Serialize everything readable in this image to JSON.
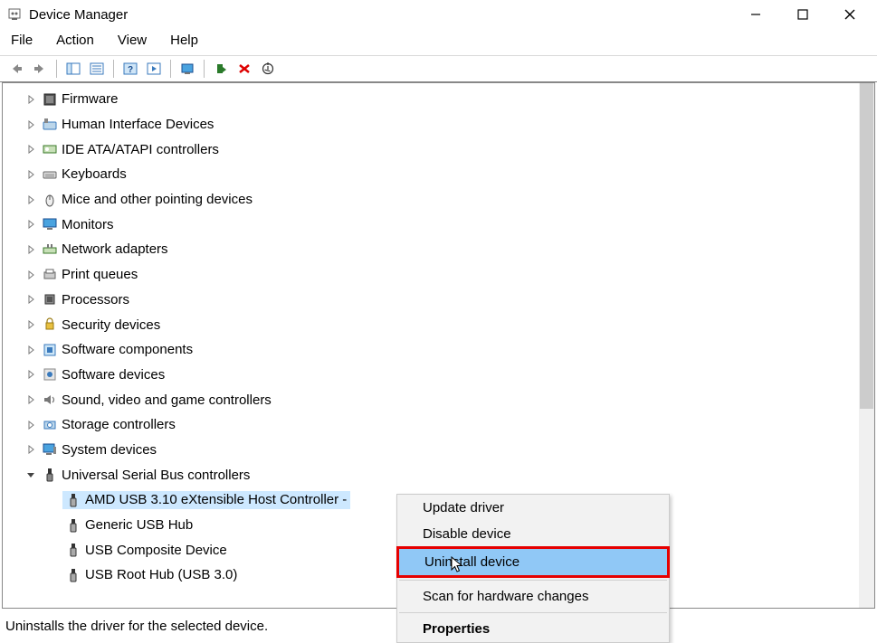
{
  "window": {
    "title": "Device Manager"
  },
  "menu": {
    "file": "File",
    "action": "Action",
    "view": "View",
    "help": "Help"
  },
  "tree": {
    "items": [
      {
        "icon": "firmware",
        "label": "Firmware",
        "expanded": false,
        "level": 1
      },
      {
        "icon": "hid",
        "label": "Human Interface Devices",
        "expanded": false,
        "level": 1
      },
      {
        "icon": "ide",
        "label": "IDE ATA/ATAPI controllers",
        "expanded": false,
        "level": 1
      },
      {
        "icon": "keyboard",
        "label": "Keyboards",
        "expanded": false,
        "level": 1
      },
      {
        "icon": "mouse",
        "label": "Mice and other pointing devices",
        "expanded": false,
        "level": 1
      },
      {
        "icon": "monitor",
        "label": "Monitors",
        "expanded": false,
        "level": 1
      },
      {
        "icon": "network",
        "label": "Network adapters",
        "expanded": false,
        "level": 1
      },
      {
        "icon": "printer",
        "label": "Print queues",
        "expanded": false,
        "level": 1
      },
      {
        "icon": "processor",
        "label": "Processors",
        "expanded": false,
        "level": 1
      },
      {
        "icon": "security",
        "label": "Security devices",
        "expanded": false,
        "level": 1
      },
      {
        "icon": "swcomp",
        "label": "Software components",
        "expanded": false,
        "level": 1
      },
      {
        "icon": "swdev",
        "label": "Software devices",
        "expanded": false,
        "level": 1
      },
      {
        "icon": "sound",
        "label": "Sound, video and game controllers",
        "expanded": false,
        "level": 1
      },
      {
        "icon": "storage",
        "label": "Storage controllers",
        "expanded": false,
        "level": 1
      },
      {
        "icon": "system",
        "label": "System devices",
        "expanded": false,
        "level": 1
      },
      {
        "icon": "usb",
        "label": "Universal Serial Bus controllers",
        "expanded": true,
        "level": 1
      },
      {
        "icon": "usbdev",
        "label": "AMD USB 3.10 eXtensible Host Controller - ",
        "expanded": null,
        "level": 2,
        "selected": true
      },
      {
        "icon": "usbdev",
        "label": "Generic USB Hub",
        "expanded": null,
        "level": 2
      },
      {
        "icon": "usbdev",
        "label": "USB Composite Device",
        "expanded": null,
        "level": 2
      },
      {
        "icon": "usbdev",
        "label": "USB Root Hub (USB 3.0)",
        "expanded": null,
        "level": 2
      }
    ]
  },
  "context_menu": {
    "items": [
      {
        "label": "Update driver",
        "type": "item"
      },
      {
        "label": "Disable device",
        "type": "item"
      },
      {
        "label": "Uninstall device",
        "type": "item",
        "highlighted": true,
        "boxed": true
      },
      {
        "type": "separator"
      },
      {
        "label": "Scan for hardware changes",
        "type": "item"
      },
      {
        "type": "separator"
      },
      {
        "label": "Properties",
        "type": "item",
        "bold": true
      }
    ]
  },
  "statusbar": {
    "text": "Uninstalls the driver for the selected device."
  }
}
